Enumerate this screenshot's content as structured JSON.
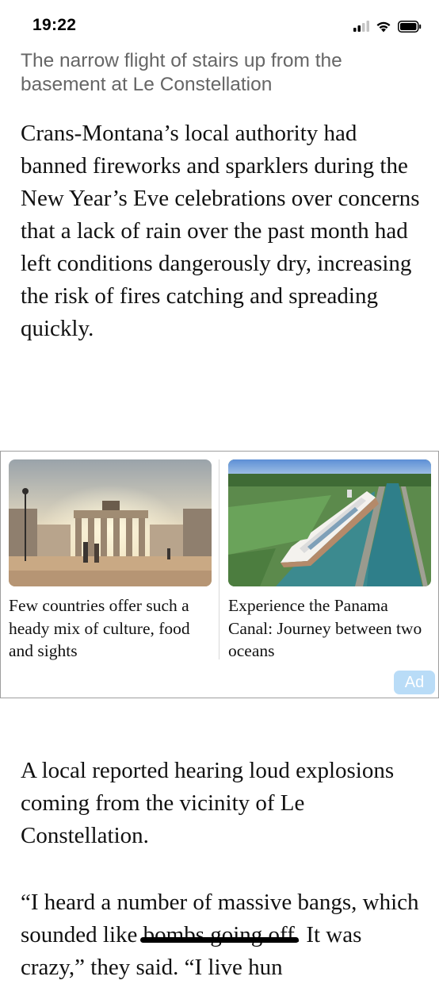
{
  "status_bar": {
    "time": "19:22",
    "icons": [
      "cellular-signal-icon",
      "wifi-icon",
      "battery-icon"
    ]
  },
  "article": {
    "caption": "The narrow flight of stairs up from the basement at Le Constellation",
    "paragraph_1": "Crans-Montana’s local authority had banned fireworks and sparklers during the New Year’s Eve celebrations over concerns that a lack of rain over the past month had left conditions dangerously dry, increasing the risk of fires catching and spreading quickly.",
    "paragraph_2": "A local reported hearing loud explosions coming from the vicinity of Le Constellation.",
    "paragraph_3": "“I heard a number of massive bangs, which sounded like bombs going off. It was crazy,” they said. “I live hun"
  },
  "ad": {
    "cards": [
      {
        "title": "Few countries offer such a heady mix of culture, food and sights",
        "image": "brandenburg-gate-photo"
      },
      {
        "title": "Experience the Panama Canal: Journey between two oceans",
        "image": "cruise-ship-canal-photo"
      }
    ],
    "badge": "Ad",
    "colors": {
      "badge_bg": "#b9dcf7",
      "border": "#9e9e9e"
    }
  }
}
